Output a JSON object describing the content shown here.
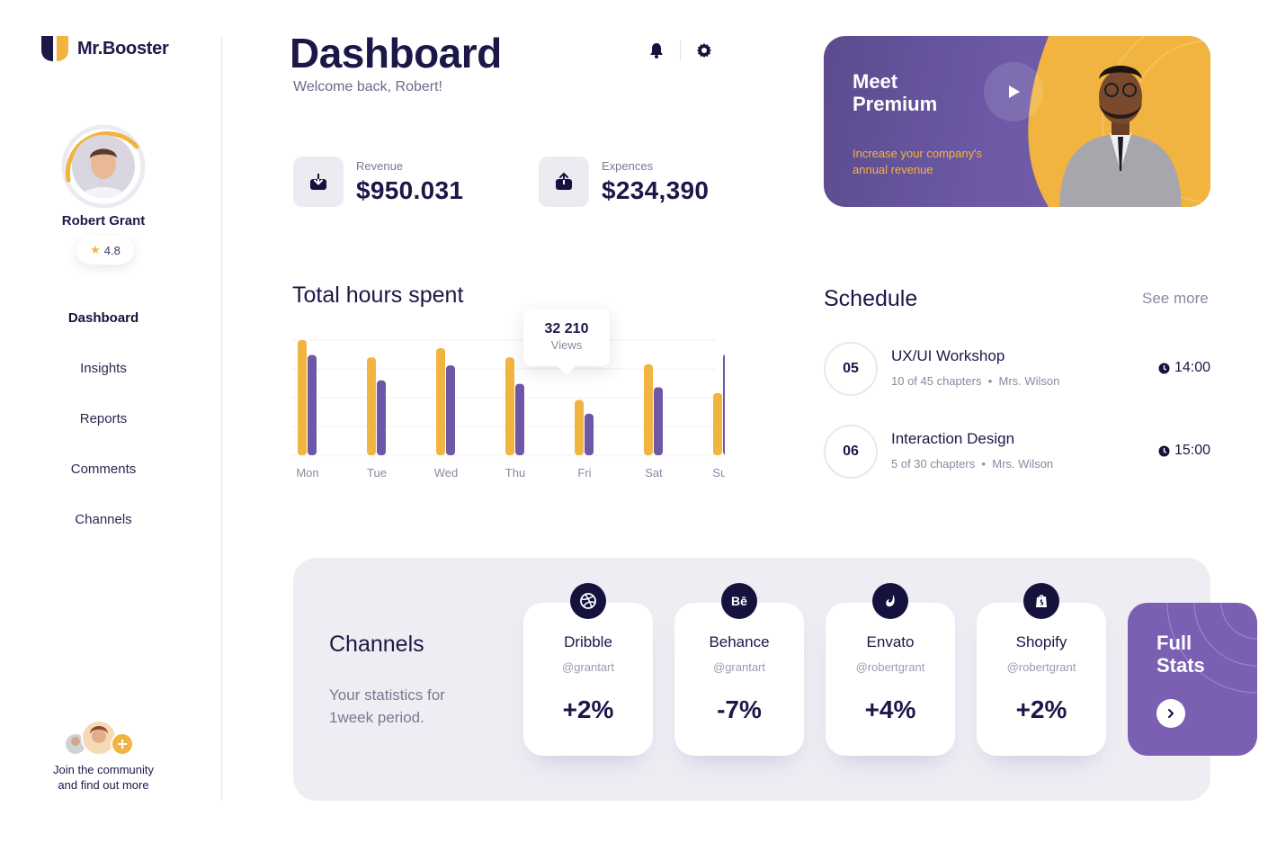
{
  "brand": {
    "name": "Mr.Booster"
  },
  "profile": {
    "name": "Robert Grant",
    "rating": "4.8"
  },
  "nav": {
    "items": [
      "Dashboard",
      "Insights",
      "Reports",
      "Comments",
      "Channels"
    ],
    "active": "Dashboard"
  },
  "community": {
    "line1": "Join the community",
    "line2": "and find out more",
    "add_icon": "plus-icon"
  },
  "header": {
    "title": "Dashboard",
    "welcome": "Welcome back, Robert!",
    "icons": [
      "bell-icon",
      "gear-icon"
    ]
  },
  "stats": {
    "revenue": {
      "label": "Revenue",
      "value": "$950.031",
      "icon": "download-icon"
    },
    "expenses": {
      "label": "Expences",
      "value": "$234,390",
      "icon": "upload-icon"
    }
  },
  "promo": {
    "title_line1": "Meet",
    "title_line2": "Premium",
    "subtitle": "Increase your company's annual revenue",
    "play_icon": "play-icon"
  },
  "chart_data": {
    "type": "bar",
    "title": "Total hours spent",
    "categories": [
      "Mon",
      "Tue",
      "Wed",
      "Thu",
      "Fri",
      "Sat",
      "Sun"
    ],
    "series": [
      {
        "values": [
          100,
          85,
          93,
          85,
          48,
          79,
          54
        ]
      },
      {
        "values": [
          87,
          65,
          78,
          62,
          36,
          59,
          88
        ]
      }
    ],
    "ylim": [
      0,
      100
    ],
    "grid": true,
    "colors": [
      "#f2b440",
      "#6f57a8"
    ],
    "tooltip": {
      "value": "32 210",
      "label": "Views",
      "category": "Fri"
    }
  },
  "schedule": {
    "title": "Schedule",
    "see_more": "See more",
    "items": [
      {
        "date": "05",
        "title": "UX/UI Workshop",
        "chapters": "10 of 45 chapters",
        "teacher": "Mrs. Wilson",
        "time": "14:00"
      },
      {
        "date": "06",
        "title": "Interaction Design",
        "chapters": "5 of 30 chapters",
        "teacher": "Mrs. Wilson",
        "time": "15:00"
      }
    ]
  },
  "channels": {
    "title": "Channels",
    "subtitle": "Your statistics for 1week  period.",
    "items": [
      {
        "name": "Dribble",
        "handle": "@grantart",
        "change": "+2%",
        "icon": "dribbble-icon"
      },
      {
        "name": "Behance",
        "handle": "@grantart",
        "change": "-7%",
        "icon": "behance-icon",
        "icon_text": "Bē"
      },
      {
        "name": "Envato",
        "handle": "@robertgrant",
        "change": "+4%",
        "icon": "envato-icon"
      },
      {
        "name": "Shopify",
        "handle": "@robertgrant",
        "change": "+2%",
        "icon": "shopify-icon"
      }
    ],
    "full_stats": {
      "line1": "Full",
      "line2": "Stats",
      "icon": "chevron-right-icon"
    }
  },
  "colors": {
    "primary": "#1b1848",
    "accent_yellow": "#f2b440",
    "accent_purple": "#6f57a8",
    "panel": "#eeedf3"
  }
}
